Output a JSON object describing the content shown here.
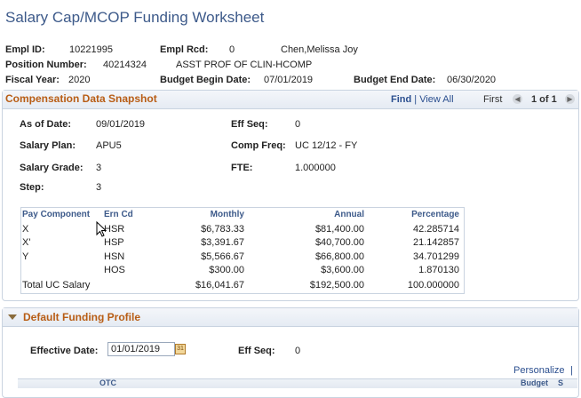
{
  "page": {
    "title": "Salary Cap/MCOP Funding Worksheet"
  },
  "header": {
    "empl_id_label": "Empl ID:",
    "empl_id": "10221995",
    "empl_rcd_label": "Empl Rcd:",
    "empl_rcd": "0",
    "name": "Chen,Melissa Joy",
    "position_label": "Position Number:",
    "position": "40214324",
    "job_title": "ASST PROF OF CLIN-HCOMP",
    "fiscal_label": "Fiscal Year:",
    "fiscal": "2020",
    "begin_label": "Budget Begin Date:",
    "begin": "07/01/2019",
    "end_label": "Budget End Date:",
    "end": "06/30/2020"
  },
  "comp": {
    "title": "Compensation Data Snapshot",
    "find": "Find",
    "sep": "|",
    "view_all": "View All",
    "first": "First",
    "page": "1 of 1",
    "asof_label": "As of Date:",
    "asof": "09/01/2019",
    "effseq_label": "Eff Seq:",
    "effseq": "0",
    "plan_label": "Salary Plan:",
    "plan": "APU5",
    "freq_label": "Comp Freq:",
    "freq": "UC 12/12 - FY",
    "grade_label": "Salary Grade:",
    "grade": "3",
    "fte_label": "FTE:",
    "fte": "1.000000",
    "step_label": "Step:",
    "step": "3"
  },
  "grid": {
    "columns": [
      "Pay Component",
      "Ern Cd",
      "Monthly",
      "Annual",
      "Percentage"
    ],
    "rows": [
      {
        "pay": "X",
        "ern": "HSR",
        "monthly": "$6,783.33",
        "annual": "$81,400.00",
        "pct": "42.285714"
      },
      {
        "pay": "X'",
        "ern": "HSP",
        "monthly": "$3,391.67",
        "annual": "$40,700.00",
        "pct": "21.142857"
      },
      {
        "pay": "Y",
        "ern": "HSN",
        "monthly": "$5,566.67",
        "annual": "$66,800.00",
        "pct": "34.701299"
      },
      {
        "pay": "",
        "ern": "HOS",
        "monthly": "$300.00",
        "annual": "$3,600.00",
        "pct": "1.870130"
      },
      {
        "pay": "Total UC Salary",
        "ern": "",
        "monthly": "$16,041.67",
        "annual": "$192,500.00",
        "pct": "100.000000"
      }
    ]
  },
  "funding": {
    "title": "Default Funding Profile",
    "eff_date_label": "Effective Date:",
    "eff_date": "01/01/2019",
    "eff_seq_label": "Eff Seq:",
    "eff_seq": "0",
    "personalize": "Personalize",
    "col_otc": "OTC",
    "col_budget": "Budget",
    "col_s": "S"
  }
}
